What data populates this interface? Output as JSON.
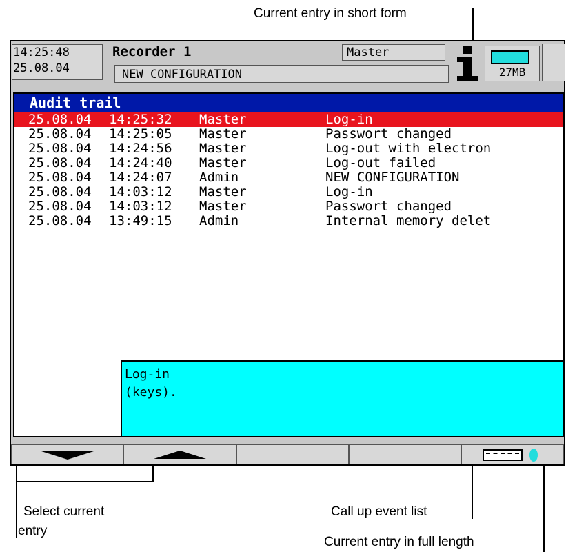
{
  "callouts": {
    "short_form": "Current entry in short form",
    "select_entry_line1": "Select current",
    "select_entry_line2": "entry",
    "event_list": "Call up event list",
    "full_length": "Current entry in full length"
  },
  "header": {
    "time": "14:25:48",
    "date": "25.08.04",
    "recorder_title": "Recorder 1",
    "user": "Master",
    "status_message": "NEW CONFIGURATION",
    "memory_label": "27MB"
  },
  "audit_trail": {
    "title": "Audit trail",
    "rows": [
      {
        "date": "25.08.04",
        "time": "14:25:32",
        "user": "Master",
        "text": "Log-in"
      },
      {
        "date": "25.08.04",
        "time": "14:25:05",
        "user": "Master",
        "text": "Passwort changed"
      },
      {
        "date": "25.08.04",
        "time": "14:24:56",
        "user": "Master",
        "text": "Log-out with electron"
      },
      {
        "date": "25.08.04",
        "time": "14:24:40",
        "user": "Master",
        "text": "Log-out failed"
      },
      {
        "date": "25.08.04",
        "time": "14:24:07",
        "user": "Admin",
        "text": "NEW CONFIGURATION"
      },
      {
        "date": "25.08.04",
        "time": "14:03:12",
        "user": "Master",
        "text": "Log-in"
      },
      {
        "date": "25.08.04",
        "time": "14:03:12",
        "user": "Master",
        "text": "Passwort changed"
      },
      {
        "date": "25.08.04",
        "time": "13:49:15",
        "user": "Admin",
        "text": "Internal memory delet"
      }
    ],
    "selected_index": 0,
    "detail_line1": "Log-in",
    "detail_line2": "(keys)."
  },
  "softkeys": {
    "icons": [
      "arrow-down-icon",
      "arrow-up-icon",
      "",
      "",
      "event-list-icon"
    ]
  },
  "colors": {
    "title_bar": "#0018a8",
    "selected_row": "#e8141e",
    "detail_panel": "#00ffff",
    "memory_card": "#22dddd"
  }
}
